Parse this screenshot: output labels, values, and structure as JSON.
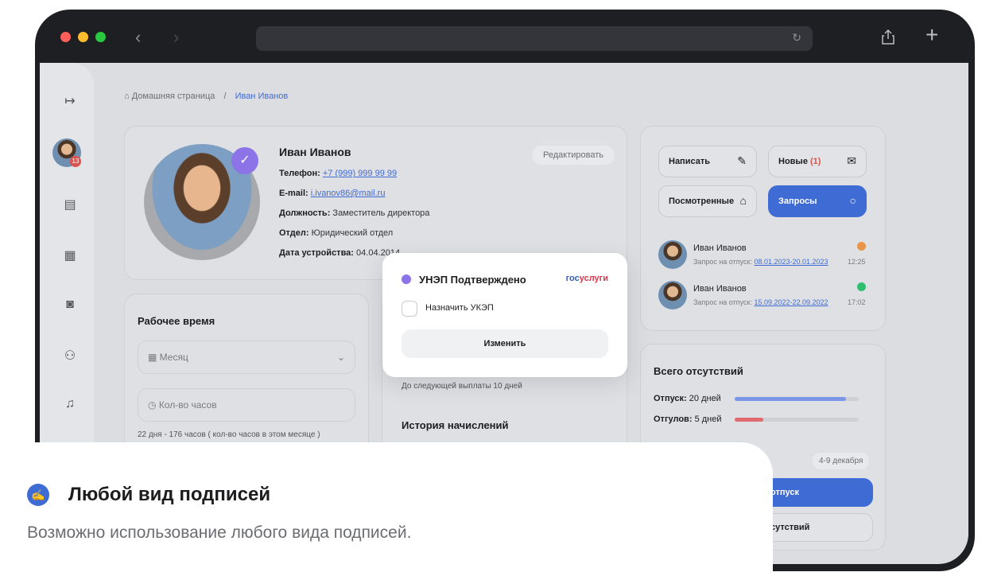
{
  "browser": {
    "icons": {
      "back": "chevron-left-icon",
      "forward": "chevron-right-icon",
      "reload": "reload-icon",
      "share": "share-icon",
      "new_tab": "plus-icon"
    }
  },
  "sidebar": {
    "badge_count": "13"
  },
  "breadcrumb": {
    "home": "Домашняя страница",
    "separator": "/",
    "current": "Иван Иванов"
  },
  "profile": {
    "name": "Иван Иванов",
    "edit_label": "Редактировать",
    "phone_label": "Телефон:",
    "phone": "+7 (999) 999 99 99",
    "email_label": "E-mail:",
    "email": "i.ivanov86@mail.ru",
    "position_label": "Должность:",
    "position": "Заместитель директора",
    "dept_label": "Отдел:",
    "dept": "Юридический отдел",
    "hire_label": "Дата устройства:",
    "hire": "04.04.2014"
  },
  "work_time": {
    "title": "Рабочее время",
    "period_placeholder": "Месяц",
    "hours_placeholder": "Кол-во часов",
    "summary": "22 дня - 176 часов ( кол-во часов в этом месяце )"
  },
  "payments": {
    "next_label": "До следующей выплаты 10 дней",
    "history_title": "История начислений"
  },
  "messages": {
    "write": "Написать",
    "new_label": "Новые",
    "new_count": "(1)",
    "viewed": "Посмотренные",
    "requests": "Запросы",
    "items": [
      {
        "name": "Иван Иванов",
        "sub": "Запрос на отпуск:",
        "range": "08.01.2023-20.01.2023",
        "time": "12:25",
        "status_color": "#e8954a"
      },
      {
        "name": "Иван Иванов",
        "sub": "Запрос на отпуск:",
        "range": "15.09.2022-22.09.2022",
        "time": "17:02",
        "status_color": "#2fbf71"
      }
    ]
  },
  "absences": {
    "title": "Всего отсутствий",
    "vacation_label": "Отпуск:",
    "vacation_value": "20 дней",
    "vacation_fraction": 0.9,
    "dayoff_label": "Отгулов:",
    "dayoff_value": "5 дней",
    "dayoff_fraction": 0.23,
    "range": "4-9 декабря",
    "vacation_button": "отпуск",
    "absence_button": "сутствий"
  },
  "popup": {
    "title": "УНЭП Подтверждено",
    "provider_a": "гос",
    "provider_b": "услуги",
    "checkbox_label": "Назначить УКЭП",
    "button": "Изменить"
  },
  "feature": {
    "title": "Любой вид подписей",
    "description": "Возможно использование любого вида подписей."
  }
}
